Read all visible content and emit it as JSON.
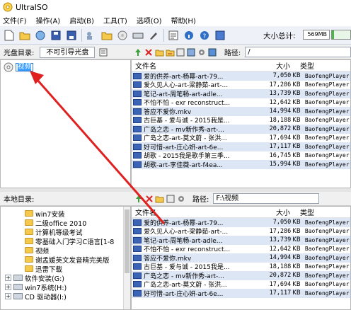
{
  "app": {
    "title": "UltraISO"
  },
  "menu": [
    "文件(F)",
    "操作(A)",
    "启动(B)",
    "工具(T)",
    "选项(O)",
    "帮助(H)"
  ],
  "toolbar": {
    "total_label": "大小总计:",
    "total_value": "569MB",
    "total_fill_fraction": 0.12,
    "icons": [
      "new-icon",
      "open-icon",
      "save-icon",
      "save-as-icon",
      "extract-icon",
      "add-files-icon",
      "add-folder-icon",
      "burn-icon",
      "virtual-drive-icon",
      "properties-icon",
      "help-icon"
    ]
  },
  "disc_pane": {
    "label": "光盘目录:",
    "boot_field": "不可引导光盘",
    "path_label": "路径:",
    "path_value": "/",
    "tree_root_rename": "视频"
  },
  "local_pane": {
    "label": "本地目录:",
    "path_label": "路径:",
    "path_value": "F:\\视频",
    "tree": [
      {
        "label": "win7安装",
        "indent": 1
      },
      {
        "label": "二级office 2010",
        "indent": 1
      },
      {
        "label": "计算机等级考试",
        "indent": 1
      },
      {
        "label": "零基础入门学习C语言[1-8",
        "indent": 1
      },
      {
        "label": "视频",
        "indent": 1
      },
      {
        "label": "谢孟媛英文发音精完美版",
        "indent": 1
      },
      {
        "label": "迅雷下载",
        "indent": 1
      },
      {
        "label": "软件安装(G:)",
        "indent": 0,
        "drive": true
      },
      {
        "label": "win7系统(H:)",
        "indent": 0,
        "drive": true
      },
      {
        "label": "CD 驱动器(I:)",
        "indent": 0,
        "drive": true
      }
    ]
  },
  "columns": {
    "name": "文件名",
    "size": "大小",
    "type": "类型"
  },
  "files": [
    {
      "name": "爱的供养-art-杨幂-art-79...",
      "size": "7,050",
      "unit": "KB",
      "type": "BaofengPlayer.m"
    },
    {
      "name": "爱久见人心-art-梁静茹-art-...",
      "size": "17,286",
      "unit": "KB",
      "type": "BaofengPlayer.m"
    },
    {
      "name": "笔记-art-周笔畅-art-adle...",
      "size": "13,739",
      "unit": "KB",
      "type": "BaofengPlayer.m"
    },
    {
      "name": "不怕不怕 - exr reconstruct...",
      "size": "12,642",
      "unit": "KB",
      "type": "BaofengPlayer.m"
    },
    {
      "name": "答应不爱你.mkv",
      "size": "14,994",
      "unit": "KB",
      "type": "BaofengPlayer.m"
    },
    {
      "name": "古巨基 - 爱与诚 - 2015我是...",
      "size": "18,188",
      "unit": "KB",
      "type": "BaofengPlayer.m"
    },
    {
      "name": "广岛之恋 - mv新作秀-art-...",
      "size": "20,872",
      "unit": "KB",
      "type": "BaofengPlayer.m"
    },
    {
      "name": "广岛之恋-art-莫文蔚 - 张洪...",
      "size": "17,694",
      "unit": "KB",
      "type": "BaofengPlayer.m"
    },
    {
      "name": "好可惜-art-庄心妍-art-6e...",
      "size": "17,117",
      "unit": "KB",
      "type": "BaofengPlayer.m"
    },
    {
      "name": "胡歌 - 2015我是歌手第三季...",
      "size": "16,745",
      "unit": "KB",
      "type": "BaofengPlayer.m"
    },
    {
      "name": "胡歌-art-李佳薇-art-f4ea...",
      "size": "15,994",
      "unit": "KB",
      "type": "BaofengPlayer.m"
    }
  ],
  "files_bottom": [
    {
      "name": "爱的供养-art-杨幂-art-79...",
      "size": "7,050",
      "unit": "KB",
      "type": "BaofengPlayer.m"
    },
    {
      "name": "爱久见人心-art-梁静茹-art-...",
      "size": "17,286",
      "unit": "KB",
      "type": "BaofengPlayer.m"
    },
    {
      "name": "笔记-art-周笔畅-art-adle...",
      "size": "13,739",
      "unit": "KB",
      "type": "BaofengPlayer.m"
    },
    {
      "name": "不怕不怕 - exr reconstruct...",
      "size": "12,642",
      "unit": "KB",
      "type": "BaofengPlayer.m"
    },
    {
      "name": "答应不爱你.mkv",
      "size": "14,994",
      "unit": "KB",
      "type": "BaofengPlayer.m"
    },
    {
      "name": "古巨基 - 爱与诚 - 2015我是...",
      "size": "18,188",
      "unit": "KB",
      "type": "BaofengPlayer.m"
    },
    {
      "name": "广岛之恋 - mv新作秀-art-...",
      "size": "20,872",
      "unit": "KB",
      "type": "BaofengPlayer.m"
    },
    {
      "name": "广岛之恋-art-莫文蔚 - 张洪...",
      "size": "17,694",
      "unit": "KB",
      "type": "BaofengPlayer.m"
    },
    {
      "name": "好可惜-art-庄心妍-art-6e...",
      "size": "17,117",
      "unit": "KB",
      "type": "BaofengPlayer.m"
    }
  ],
  "colors": {
    "accent": "#3399ff",
    "arrow": "#e02020",
    "file_icon": "#3b64b5",
    "folder": "#f4c94c"
  }
}
